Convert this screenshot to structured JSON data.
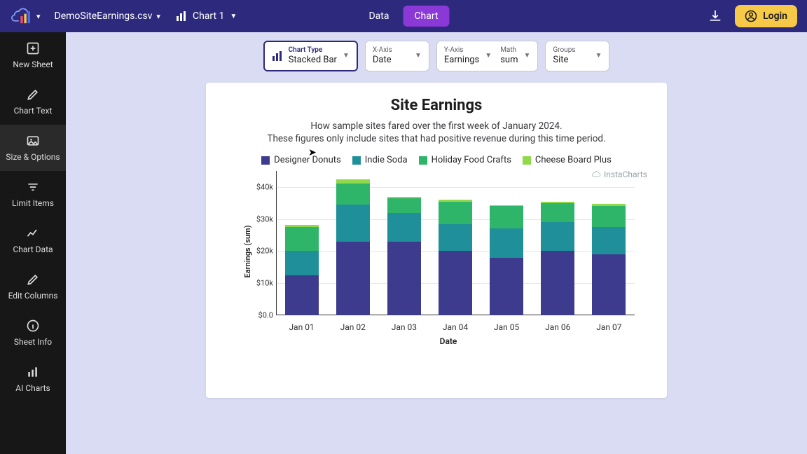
{
  "header": {
    "file_name": "DemoSiteEarnings.csv",
    "chart_selector": "Chart 1",
    "tabs": {
      "data": "Data",
      "chart": "Chart"
    },
    "login": "Login"
  },
  "sidebar": {
    "items": [
      {
        "label": "New Sheet"
      },
      {
        "label": "Chart Text"
      },
      {
        "label": "Size & Options"
      },
      {
        "label": "Limit Items"
      },
      {
        "label": "Chart Data"
      },
      {
        "label": "Edit Columns"
      },
      {
        "label": "Sheet Info"
      },
      {
        "label": "AI Charts"
      }
    ]
  },
  "config": {
    "chart_type": {
      "label": "Chart Type",
      "value": "Stacked Bar"
    },
    "x_axis": {
      "label": "X-Axis",
      "value": "Date"
    },
    "y_axis": {
      "label": "Y-Axis",
      "value": "Earnings"
    },
    "math": {
      "label": "Math",
      "value": "sum"
    },
    "groups": {
      "label": "Groups",
      "value": "Site"
    }
  },
  "watermark": "InstaCharts",
  "chart_data": {
    "type": "bar",
    "stacked": true,
    "title": "Site Earnings",
    "subtitle": "How sample sites fared over the first week of January 2024.\nThese figures only include sites that had positive revenue during this time period.",
    "xlabel": "Date",
    "ylabel": "Earnings (sum)",
    "ylim": [
      0,
      45000
    ],
    "yticks": [
      0,
      10000,
      20000,
      30000,
      40000
    ],
    "ytick_labels": [
      "$0.0",
      "$10k",
      "$20k",
      "$30k",
      "$40k"
    ],
    "categories": [
      "Jan 01",
      "Jan 02",
      "Jan 03",
      "Jan 04",
      "Jan 05",
      "Jan 06",
      "Jan 07"
    ],
    "series": [
      {
        "name": "Designer Donuts",
        "color": "#3d3b8e",
        "values": [
          12500,
          23000,
          23000,
          20000,
          18000,
          20000,
          19000
        ]
      },
      {
        "name": "Indie Soda",
        "color": "#1f8f9a",
        "values": [
          7500,
          11500,
          9000,
          8500,
          9000,
          9000,
          8500
        ]
      },
      {
        "name": "Holiday Food Crafts",
        "color": "#2fb56a",
        "values": [
          7500,
          6500,
          4500,
          7000,
          7000,
          6000,
          6500
        ]
      },
      {
        "name": "Cheese Board Plus",
        "color": "#8fd94a",
        "values": [
          700,
          1300,
          500,
          500,
          300,
          300,
          700
        ]
      }
    ]
  }
}
